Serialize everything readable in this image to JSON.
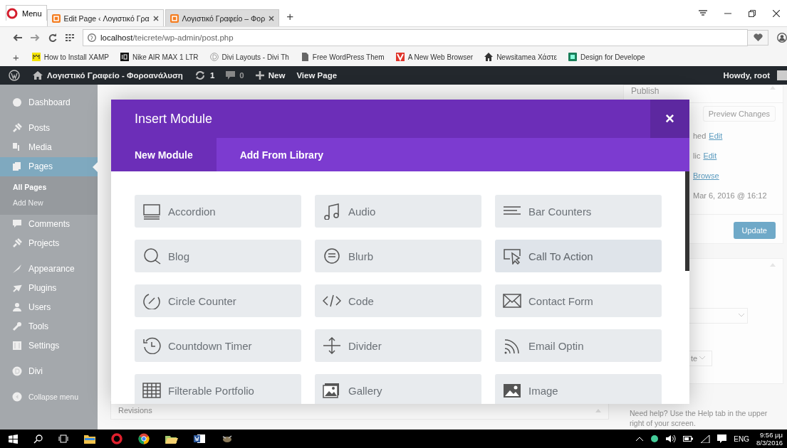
{
  "browser": {
    "menu_label": "Menu",
    "tabs": [
      {
        "title": "Edit Page ‹ Λογιστικό Γρα",
        "selected": true
      },
      {
        "title": "Λογιστικό Γραφείο – Φορ",
        "selected": false
      }
    ],
    "new_tab": "+",
    "url_host": "localhost",
    "url_path": "/teicrete/wp-admin/post.php",
    "bookmarks_add": "+",
    "bookmarks": [
      "How to Install XAMP",
      "Nike AIR MAX 1 LTR",
      "Divi Layouts - Divi Th",
      "Free WordPress Them",
      "A New Web Browser",
      "Newsitamea Χάστε",
      "Design for Develope"
    ]
  },
  "admin_bar": {
    "site": "Λογιστικό Γραφείο - Φοροανάλυση",
    "updates": "1",
    "comments": "0",
    "new": "New",
    "view": "View Page",
    "greeting": "Howdy, root"
  },
  "sidebar": {
    "groups": [
      [
        {
          "label": "Dashboard",
          "selected": false
        }
      ],
      [
        {
          "label": "Posts",
          "selected": false
        },
        {
          "label": "Media",
          "selected": false
        },
        {
          "label": "Pages",
          "selected": true,
          "children": [
            {
              "label": "All Pages",
              "selected": true
            },
            {
              "label": "Add New",
              "selected": false
            }
          ]
        },
        {
          "label": "Comments",
          "selected": false
        },
        {
          "label": "Projects",
          "selected": false
        }
      ],
      [
        {
          "label": "Appearance",
          "selected": false
        },
        {
          "label": "Plugins",
          "selected": false
        },
        {
          "label": "Users",
          "selected": false
        },
        {
          "label": "Tools",
          "selected": false
        },
        {
          "label": "Settings",
          "selected": false
        }
      ],
      [
        {
          "label": "Divi",
          "selected": false
        }
      ]
    ],
    "collapse": "Collapse menu"
  },
  "editor": {
    "revisions": "Revisions"
  },
  "publish": {
    "title": "Publish",
    "preview": "Preview Changes",
    "status_fragment": "hed",
    "status_link": "Edit",
    "visibility_fragment": "lic",
    "visibility_link": "Edit",
    "browse_link": "Browse",
    "date_fragment": "Mar 6, 2016 @ 16:12",
    "update": "Update"
  },
  "attributes": {
    "select_fragment": "te"
  },
  "help": [
    "Need help? Use the Help tab in the upper",
    "right of your screen."
  ],
  "modal": {
    "title": "Insert Module",
    "close": "×",
    "tabs": [
      {
        "label": "New Module",
        "selected": true
      },
      {
        "label": "Add From Library",
        "selected": false
      }
    ],
    "modules": [
      {
        "label": "Accordion",
        "hovered": false
      },
      {
        "label": "Audio",
        "hovered": false
      },
      {
        "label": "Bar Counters",
        "hovered": false
      },
      {
        "label": "Blog",
        "hovered": false
      },
      {
        "label": "Blurb",
        "hovered": false
      },
      {
        "label": "Call To Action",
        "hovered": true
      },
      {
        "label": "Circle Counter",
        "hovered": false
      },
      {
        "label": "Code",
        "hovered": false
      },
      {
        "label": "Contact Form",
        "hovered": false
      },
      {
        "label": "Countdown Timer",
        "hovered": false
      },
      {
        "label": "Divider",
        "hovered": false
      },
      {
        "label": "Email Optin",
        "hovered": false
      },
      {
        "label": "Filterable Portfolio",
        "hovered": false
      },
      {
        "label": "Gallery",
        "hovered": false
      },
      {
        "label": "Image",
        "hovered": false
      }
    ]
  },
  "taskbar": {
    "language": "ENG",
    "time": "9:56 μμ",
    "date": "8/3/2016"
  }
}
